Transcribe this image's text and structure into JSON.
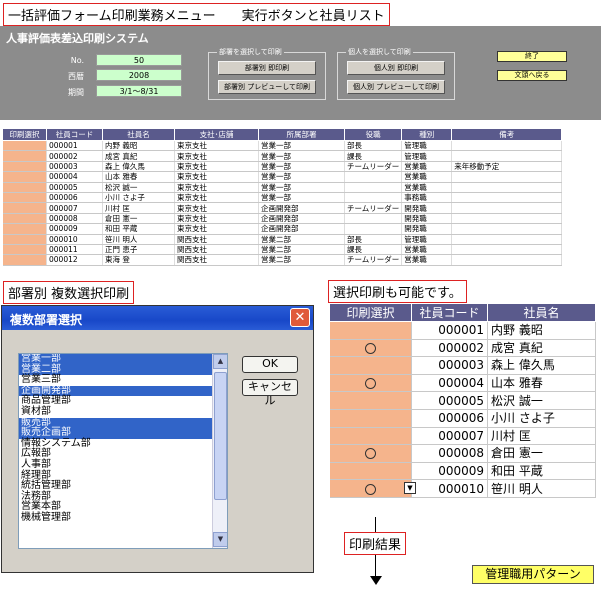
{
  "header_label": "一括評価フォーム印刷業務メニュー　　実行ボタンと社員リスト",
  "panel": {
    "system_title": "人事評価表差込印刷システム",
    "fields": [
      {
        "label": "No.",
        "value": "50"
      },
      {
        "label": "西暦",
        "value": "2008"
      },
      {
        "label": "期間",
        "value": "3/1～8/31"
      }
    ],
    "dept_group": {
      "title": "部署を選択して印刷",
      "print_button": "部署別 即印刷",
      "preview_button": "部署別 プレビューして印刷"
    },
    "person_group": {
      "title": "個人を選択して印刷",
      "print_button": "個人別 即印刷",
      "preview_button": "個人別 プレビューして印刷"
    },
    "exit_button": "終了",
    "back_button": "文頭へ戻る"
  },
  "employee_table": {
    "headers": [
      "印刷選択",
      "社員コード",
      "社員名",
      "支社･店舗",
      "所属部署",
      "役職",
      "種別",
      "備考"
    ],
    "rows": [
      [
        "",
        "000001",
        "内野 義昭",
        "東京支社",
        "営業一部",
        "部長",
        "管理職",
        ""
      ],
      [
        "",
        "000002",
        "成宮 真紀",
        "東京支社",
        "営業一部",
        "課長",
        "管理職",
        ""
      ],
      [
        "",
        "000003",
        "森上 偉久馬",
        "東京支社",
        "営業一部",
        "チームリーダー",
        "営業職",
        "来年移動予定"
      ],
      [
        "",
        "000004",
        "山本 雅春",
        "東京支社",
        "営業一部",
        "",
        "営業職",
        ""
      ],
      [
        "",
        "000005",
        "松沢 誠一",
        "東京支社",
        "営業一部",
        "",
        "営業職",
        ""
      ],
      [
        "",
        "000006",
        "小川 さよ子",
        "東京支社",
        "営業一部",
        "",
        "事務職",
        ""
      ],
      [
        "",
        "000007",
        "川村 匡",
        "東京支社",
        "企画開発部",
        "チームリーダー",
        "開発職",
        ""
      ],
      [
        "",
        "000008",
        "倉田 憲一",
        "東京支社",
        "企画開発部",
        "",
        "開発職",
        ""
      ],
      [
        "",
        "000009",
        "和田 平蔵",
        "東京支社",
        "企画開発部",
        "",
        "開発職",
        ""
      ],
      [
        "",
        "000010",
        "笹川 明人",
        "関西支社",
        "営業二部",
        "部長",
        "管理職",
        ""
      ],
      [
        "",
        "000011",
        "正門 恵子",
        "関西支社",
        "営業二部",
        "課長",
        "営業職",
        ""
      ],
      [
        "",
        "000012",
        "東海 登",
        "関西支社",
        "営業二部",
        "チームリーダー",
        "営業職",
        ""
      ]
    ]
  },
  "dialog_caption": "部署別 複数選択印刷",
  "dialog": {
    "title": "複数部署選択",
    "close": "✕",
    "ok_button": "OK",
    "cancel_button": "キャンセル",
    "scroll_up": "▲",
    "scroll_down": "▼",
    "departments": [
      {
        "name": "営業一部",
        "selected": true
      },
      {
        "name": "営業二部",
        "selected": true
      },
      {
        "name": "営業三部",
        "selected": false
      },
      {
        "name": "企画開発部",
        "selected": true
      },
      {
        "name": "商品管理部",
        "selected": false
      },
      {
        "name": "資材部",
        "selected": false
      },
      {
        "name": "販売部",
        "selected": true
      },
      {
        "name": "販売企画部",
        "selected": true
      },
      {
        "name": "情報システム部",
        "selected": false
      },
      {
        "name": "広報部",
        "selected": false
      },
      {
        "name": "人事部",
        "selected": false
      },
      {
        "name": "経理部",
        "selected": false
      },
      {
        "name": "統括管理部",
        "selected": false
      },
      {
        "name": "法務部",
        "selected": false
      },
      {
        "name": "営業本部",
        "selected": false
      },
      {
        "name": "機械管理部",
        "selected": false
      }
    ]
  },
  "select_caption": "選択印刷も可能です。",
  "select_table": {
    "headers": [
      "印刷選択",
      "社員コード",
      "社員名"
    ],
    "mark": "○",
    "dropdown_arrow": "▼",
    "rows": [
      {
        "mark": false,
        "code": "000001",
        "name": "内野 義昭"
      },
      {
        "mark": true,
        "code": "000002",
        "name": "成宮 真紀"
      },
      {
        "mark": false,
        "code": "000003",
        "name": "森上 偉久馬"
      },
      {
        "mark": true,
        "code": "000004",
        "name": "山本 雅春"
      },
      {
        "mark": false,
        "code": "000005",
        "name": "松沢 誠一"
      },
      {
        "mark": false,
        "code": "000006",
        "name": "小川 さよ子"
      },
      {
        "mark": false,
        "code": "000007",
        "name": "川村 匡"
      },
      {
        "mark": true,
        "code": "000008",
        "name": "倉田 憲一"
      },
      {
        "mark": false,
        "code": "000009",
        "name": "和田 平蔵"
      },
      {
        "mark": true,
        "code": "000010",
        "name": "笹川 明人",
        "dropdown": true
      }
    ]
  },
  "result_label": "印刷結果",
  "pattern_label": "管理職用パターン",
  "colors": {
    "panel": "#8c8c8c",
    "header": "#5a5a8c",
    "select_cell": "#f5b48c",
    "field": "#ccffcc",
    "highlight": "#3164c8"
  }
}
